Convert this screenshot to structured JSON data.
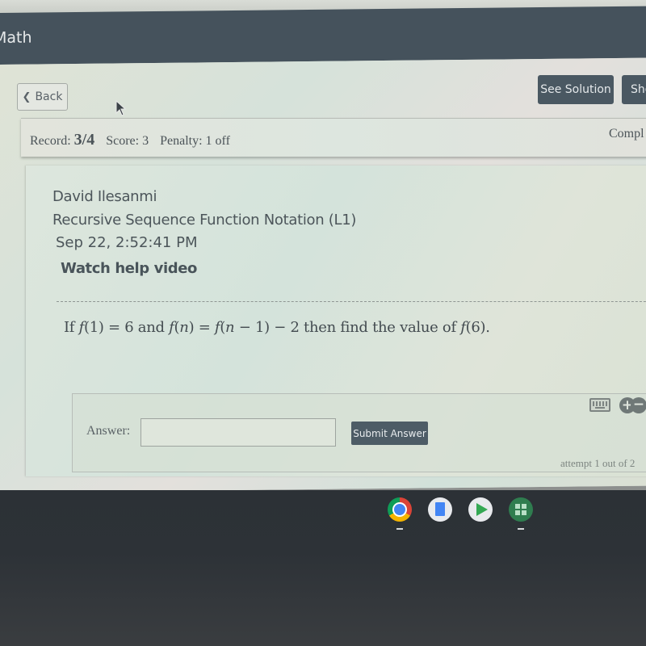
{
  "header": {
    "app_title": "Math"
  },
  "nav": {
    "back_label": "Back",
    "see_solution_label": "See Solution",
    "show_label": "Sho"
  },
  "record_bar": {
    "record_label": "Record:",
    "record_value": "3/4",
    "score_label": "Score:",
    "score_value": "3",
    "penalty_label": "Penalty:",
    "penalty_value": "1 off",
    "complete_label": "Compl"
  },
  "question": {
    "student_name": "David Ilesanmi",
    "topic": "Recursive Sequence Function Notation (L1)",
    "timestamp": "Sep 22, 2:52:41 PM",
    "help_link": "Watch help video",
    "prompt_parts": {
      "p1": "If ",
      "f1": "f",
      "p2": "(1) = 6 and ",
      "f2": "f",
      "p3": "(",
      "n1": "n",
      "p4": ") = ",
      "f3": "f",
      "p5": "(",
      "n2": "n",
      "p6": " − 1) − 2 then find the value of ",
      "f4": "f",
      "p7": "(6)."
    }
  },
  "answer": {
    "label": "Answer:",
    "value": "",
    "placeholder": "",
    "submit_label": "Submit Answer",
    "attempt_text": "attempt 1 out of 2",
    "keyboard_icon": "keyboard-icon",
    "zoom_in_symbol": "+",
    "zoom_out_symbol": "−"
  },
  "shelf": {
    "left_glyph": ")",
    "apps": [
      {
        "name": "Chrome",
        "icon": "chrome-icon"
      },
      {
        "name": "Docs",
        "icon": "docs-icon"
      },
      {
        "name": "Play Store",
        "icon": "play-store-icon"
      },
      {
        "name": "Calculator",
        "icon": "calculator-icon"
      }
    ]
  }
}
